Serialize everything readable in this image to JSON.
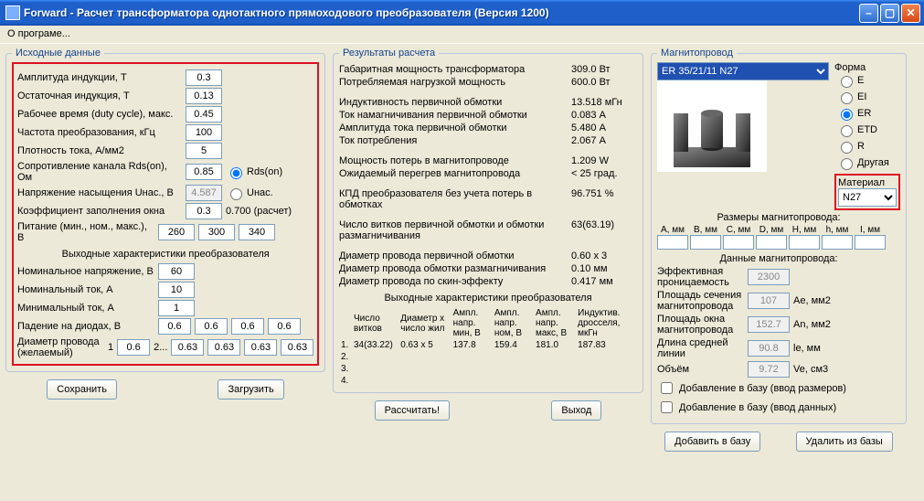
{
  "window": {
    "title": "Forward - Расчет трансформатора однотактного прямоходового преобразователя (Версия 1200)"
  },
  "menu": {
    "about": "О програме..."
  },
  "left": {
    "legend": "Исходные данные",
    "amp_ind_lbl": "Амплитуда индукции, Т",
    "amp_ind": "0.3",
    "rem_ind_lbl": "Остаточная индукция, Т",
    "rem_ind": "0.13",
    "duty_lbl": "Рабочее время (duty cycle), макс.",
    "duty": "0.45",
    "freq_lbl": "Частота преобразования, кГц",
    "freq": "100",
    "jdens_lbl": "Плотность тока, А/мм2",
    "jdens": "5",
    "rds_lbl": "Сопротивление канала Rds(on), Ом",
    "rds": "0.85",
    "rds_radio": "Rds(on)",
    "unas_lbl": "Напряжение насыщения Uнас., В",
    "unas": "4.587",
    "unas_radio": "Uнас.",
    "kz_lbl": "Коэффициент заполнения окна",
    "kz": "0.3",
    "kz_calc": "0.700 (расчет)",
    "vin_lbl": "Питание (мин., ном., макс.), В",
    "vin_min": "260",
    "vin_nom": "300",
    "vin_max": "340",
    "out_hdr": "Выходные характеристики преобразователя",
    "vnom_lbl": "Номинальное напряжение, В",
    "vnom": "60",
    "inom_lbl": "Номинальный ток, А",
    "inom": "10",
    "imin_lbl": "Минимальный ток, А",
    "imin": "1",
    "vdio_lbl": "Падение на диодах, В",
    "vd1": "0.6",
    "vd2": "0.6",
    "vd3": "0.6",
    "vd4": "0.6",
    "dwire_lbl": "Диаметр провода (желаемый)",
    "dwn1": "1",
    "dw1": "0.6",
    "dwn2": "2...",
    "dw2": "0.63",
    "dw3": "0.63",
    "dw4": "0.63",
    "dw5": "0.63",
    "btn_save": "Сохранить",
    "btn_load": "Загрузить"
  },
  "mid": {
    "legend": "Результаты расчета",
    "r1_lbl": "Габаритная мощность трансформатора",
    "r1_val": "309.0 Вт",
    "r2_lbl": "Потребляемая нагрузкой мощность",
    "r2_val": "600.0 Вт",
    "r3_lbl": "Индуктивность первичной обмотки",
    "r3_val": "13.518 мГн",
    "r4_lbl": "Ток намагничивания первичной обмотки",
    "r4_val": "0.083 А",
    "r5_lbl": "Амплитуда тока первичной обмотки",
    "r5_val": "5.480 А",
    "r6_lbl": "Ток потребления",
    "r6_val": "2.067 А",
    "r7_lbl": "Мощность потерь в магнитопроводе",
    "r7_val": "1.209 W",
    "r8_lbl": "Ожидаемый перегрев магнитопровода",
    "r8_val": "< 25 град.",
    "r9_lbl": "КПД преобразователя без учета потерь в обмотках",
    "r9_val": "96.751 %",
    "r10_lbl": "Число витков первичной обмотки и обмотки размагничивания",
    "r10_val": "63(63.19)",
    "r11_lbl": "Диаметр провода первичной обмотки",
    "r11_val": "0.60 x 3",
    "r12_lbl": "Диаметр провода обмотки размагничивания",
    "r12_val": "0.10 мм",
    "r13_lbl": "Диаметр провода по скин-эффекту",
    "r13_val": "0.417 мм",
    "out_hdr": "Выходные характеристики преобразователя",
    "th_num": "",
    "th_turns": "Число витков",
    "th_dxn": "Диаметр x число жил",
    "th_va_min": "Ампл. напр. мин, В",
    "th_va_nom": "Ампл. напр. ном, В",
    "th_va_max": "Ампл. напр. макс, В",
    "th_ldr": "Индуктив. дросселя, мкГн",
    "row1_n": "1.",
    "row1_turns": "34(33.22)",
    "row1_dxn": "0.63 x 5",
    "row1_vmin": "137.8",
    "row1_vnom": "159.4",
    "row1_vmax": "181.0",
    "row1_l": "187.83",
    "row2_n": "2.",
    "row3_n": "3.",
    "row4_n": "4.",
    "btn_calc": "Рассчитать!",
    "btn_exit": "Выход"
  },
  "right": {
    "legend": "Магнитопровод",
    "core_sel": "ER 35/21/11 N27",
    "shape_lbl": "Форма",
    "sh_e": "E",
    "sh_ei": "EI",
    "sh_er": "ER",
    "sh_etd": "ETD",
    "sh_r": "R",
    "sh_other": "Другая",
    "mat_lbl": "Материал",
    "mat_sel": "N27",
    "dims_lbl": "Размеры магнитопровода:",
    "dh_a": "A, мм",
    "dh_b": "B, мм",
    "dh_c": "C, мм",
    "dh_d": "D, мм",
    "dh_h": "H, мм",
    "dh_h2": "h, мм",
    "dh_i": "I, мм",
    "data_lbl": "Данные магнитопровода:",
    "p1_lbl": "Эффективная проницаемость",
    "p1_val": "2300",
    "p1_unit": "",
    "p2_lbl": "Площадь сечения магнитопровода",
    "p2_val": "107",
    "p2_unit": "Ae, мм2",
    "p3_lbl": "Площадь окна магнитопровода",
    "p3_val": "152.7",
    "p3_unit": "An, мм2",
    "p4_lbl": "Длина средней линии",
    "p4_val": "90.8",
    "p4_unit": "le, мм",
    "p5_lbl": "Объём",
    "p5_val": "9.72",
    "p5_unit": "Ve, см3",
    "chk1": "Добавление в базу (ввод размеров)",
    "chk2": "Добавление в базу (ввод данных)",
    "btn_add": "Добавить в базу",
    "btn_del": "Удалить из базы"
  }
}
